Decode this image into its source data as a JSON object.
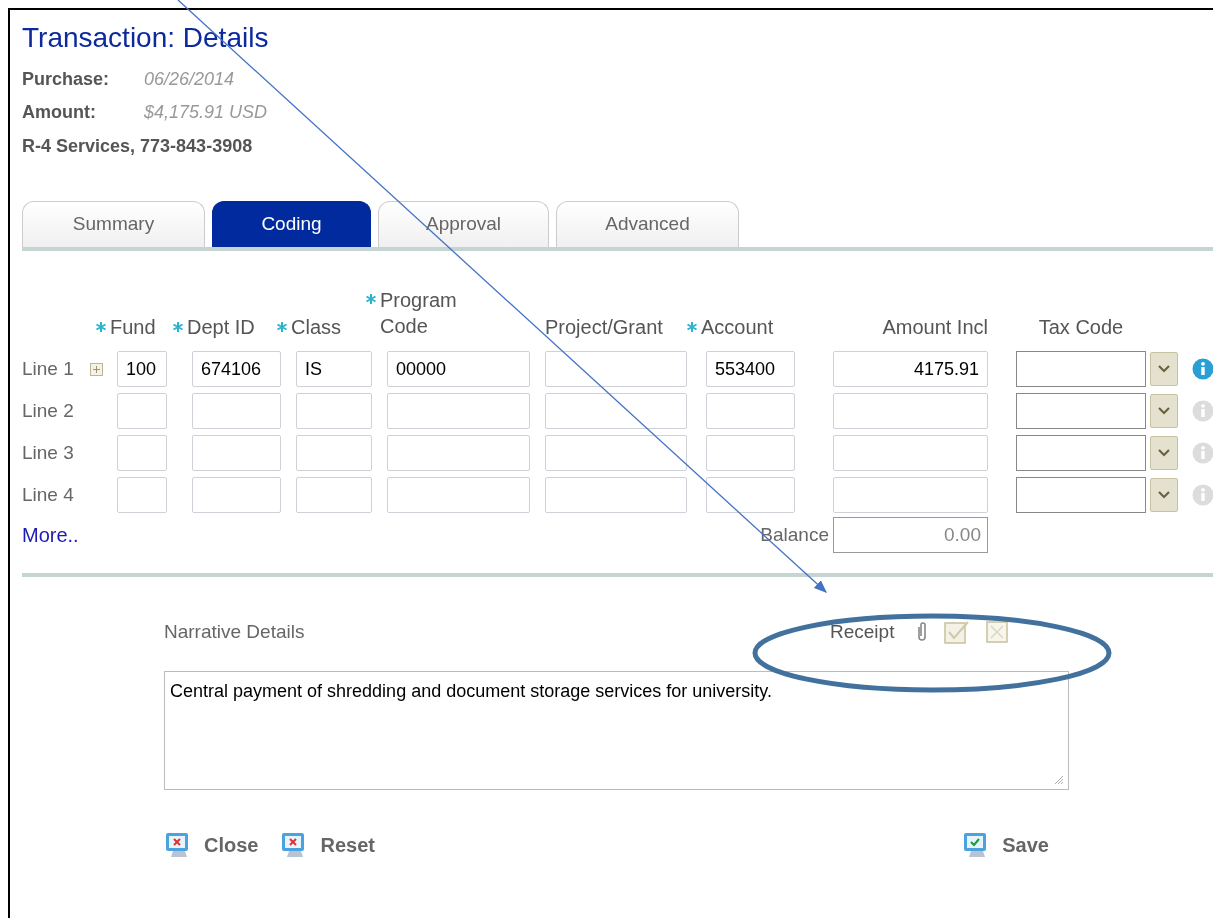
{
  "title": "Transaction: Details",
  "summary": [
    {
      "label": "Purchase:",
      "value": "06/26/2014"
    },
    {
      "label": "Amount:",
      "value": "$4,175.91 USD"
    }
  ],
  "vendor": "R-4 Services, 773-843-3908",
  "tabs": [
    {
      "label": "Summary",
      "selected": false
    },
    {
      "label": "Coding",
      "selected": true
    },
    {
      "label": "Approval",
      "selected": false
    },
    {
      "label": "Advanced",
      "selected": false
    }
  ],
  "columns": [
    {
      "label": "Fund",
      "required": true
    },
    {
      "label": "Dept ID",
      "required": true
    },
    {
      "label": "Class",
      "required": true
    },
    {
      "label": "Program Code",
      "required": true
    },
    {
      "label": "Project/Grant",
      "required": false
    },
    {
      "label": "Account",
      "required": true
    },
    {
      "label": "Amount Incl",
      "required": false
    },
    {
      "label": "Tax Code",
      "required": false
    }
  ],
  "rows": [
    {
      "label": "Line 1",
      "expandable": true,
      "info_active": true,
      "fund": "100",
      "dept_id": "674106",
      "class": "IS",
      "program_code": "00000",
      "account": "553400",
      "amount_incl": "4175.91"
    },
    {
      "label": "Line 2",
      "expandable": false,
      "info_active": false
    },
    {
      "label": "Line 3",
      "expandable": false,
      "info_active": false
    },
    {
      "label": "Line 4",
      "expandable": false,
      "info_active": false
    }
  ],
  "more_link": "More..",
  "balance": {
    "label": "Balance",
    "value": "0.00"
  },
  "narrative": {
    "label": "Narrative Details",
    "value": "Central payment of shredding and document storage services for university."
  },
  "receipt": {
    "label": "Receipt"
  },
  "buttons": [
    {
      "label": "Close",
      "kind": "cancel"
    },
    {
      "label": "Reset",
      "kind": "cancel"
    },
    {
      "label": "Save",
      "kind": "confirm"
    }
  ]
}
